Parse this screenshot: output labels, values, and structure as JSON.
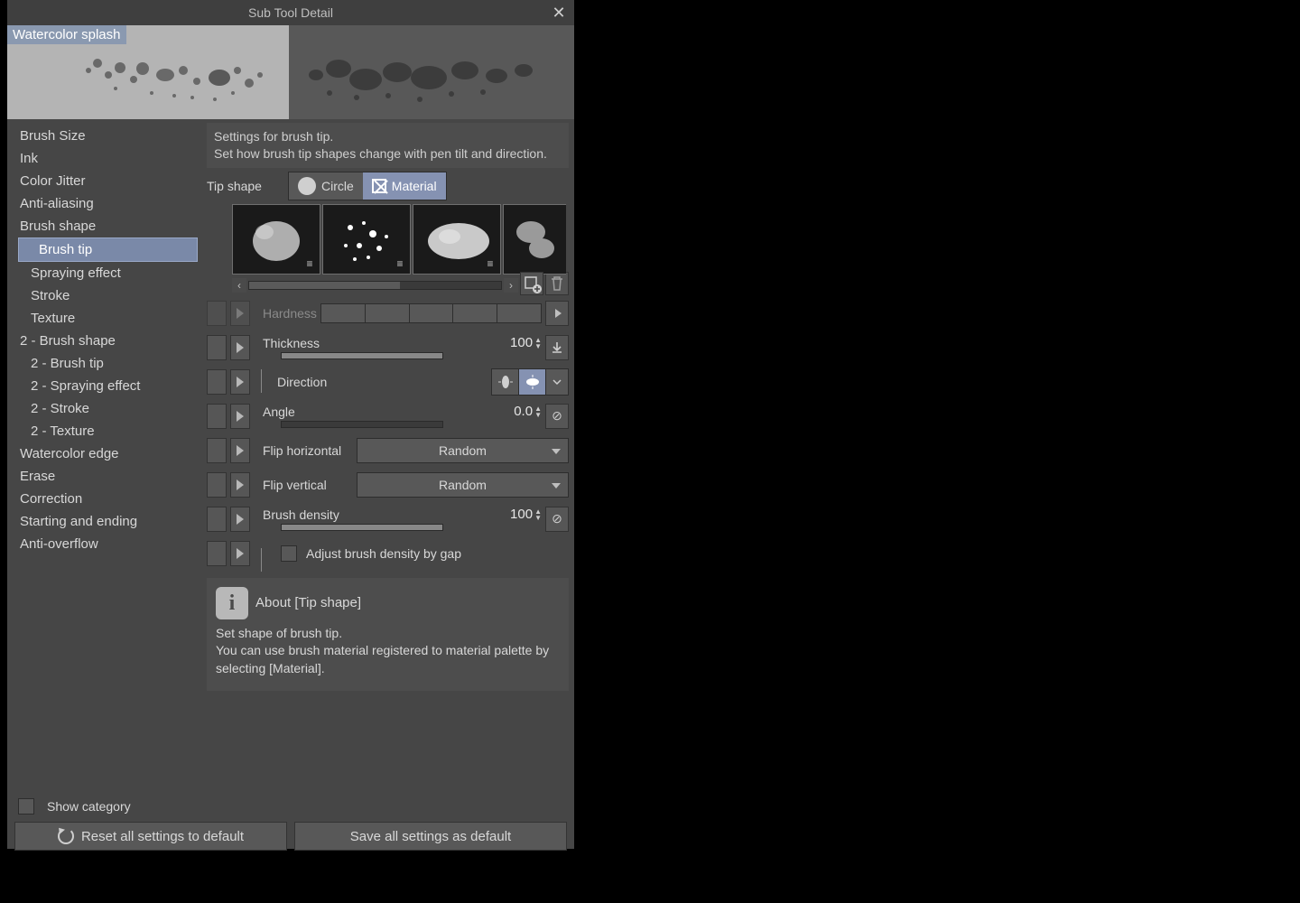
{
  "window": {
    "title": "Sub Tool Detail"
  },
  "brush_name": "Watercolor splash",
  "sidebar": {
    "items": [
      {
        "label": "Brush Size",
        "indent": false
      },
      {
        "label": "Ink",
        "indent": false
      },
      {
        "label": "Color Jitter",
        "indent": false
      },
      {
        "label": "Anti-aliasing",
        "indent": false
      },
      {
        "label": "Brush shape",
        "indent": false
      },
      {
        "label": "Brush tip",
        "indent": true,
        "selected": true
      },
      {
        "label": "Spraying effect",
        "indent": true
      },
      {
        "label": "Stroke",
        "indent": true
      },
      {
        "label": "Texture",
        "indent": true
      },
      {
        "label": "2 - Brush shape",
        "indent": false
      },
      {
        "label": "2 - Brush tip",
        "indent": true
      },
      {
        "label": "2 - Spraying effect",
        "indent": true
      },
      {
        "label": "2 - Stroke",
        "indent": true
      },
      {
        "label": "2 - Texture",
        "indent": true
      },
      {
        "label": "Watercolor edge",
        "indent": false
      },
      {
        "label": "Erase",
        "indent": false
      },
      {
        "label": "Correction",
        "indent": false
      },
      {
        "label": "Starting and ending",
        "indent": false
      },
      {
        "label": "Anti-overflow",
        "indent": false
      }
    ]
  },
  "description": "Settings for brush tip.\nSet how brush tip shapes change with pen tilt and direction.",
  "tip_shape": {
    "label": "Tip shape",
    "circle": "Circle",
    "material": "Material",
    "selected": "Material"
  },
  "params": {
    "hardness": {
      "label": "Hardness"
    },
    "thickness": {
      "label": "Thickness",
      "value": "100",
      "fill_pct": 100
    },
    "direction": {
      "label": "Direction"
    },
    "angle": {
      "label": "Angle",
      "value": "0.0",
      "fill_pct": 0
    },
    "flip_h": {
      "label": "Flip horizontal",
      "value": "Random"
    },
    "flip_v": {
      "label": "Flip vertical",
      "value": "Random"
    },
    "density": {
      "label": "Brush density",
      "value": "100",
      "fill_pct": 100
    },
    "adjust_gap": {
      "label": "Adjust brush density by gap"
    }
  },
  "about": {
    "heading": "About [Tip shape]",
    "body": "Set shape of brush tip.\nYou can use brush material registered to material palette by selecting [Material]."
  },
  "footer": {
    "show_category": "Show category",
    "reset": "Reset all settings to default",
    "save": "Save all settings as default"
  }
}
